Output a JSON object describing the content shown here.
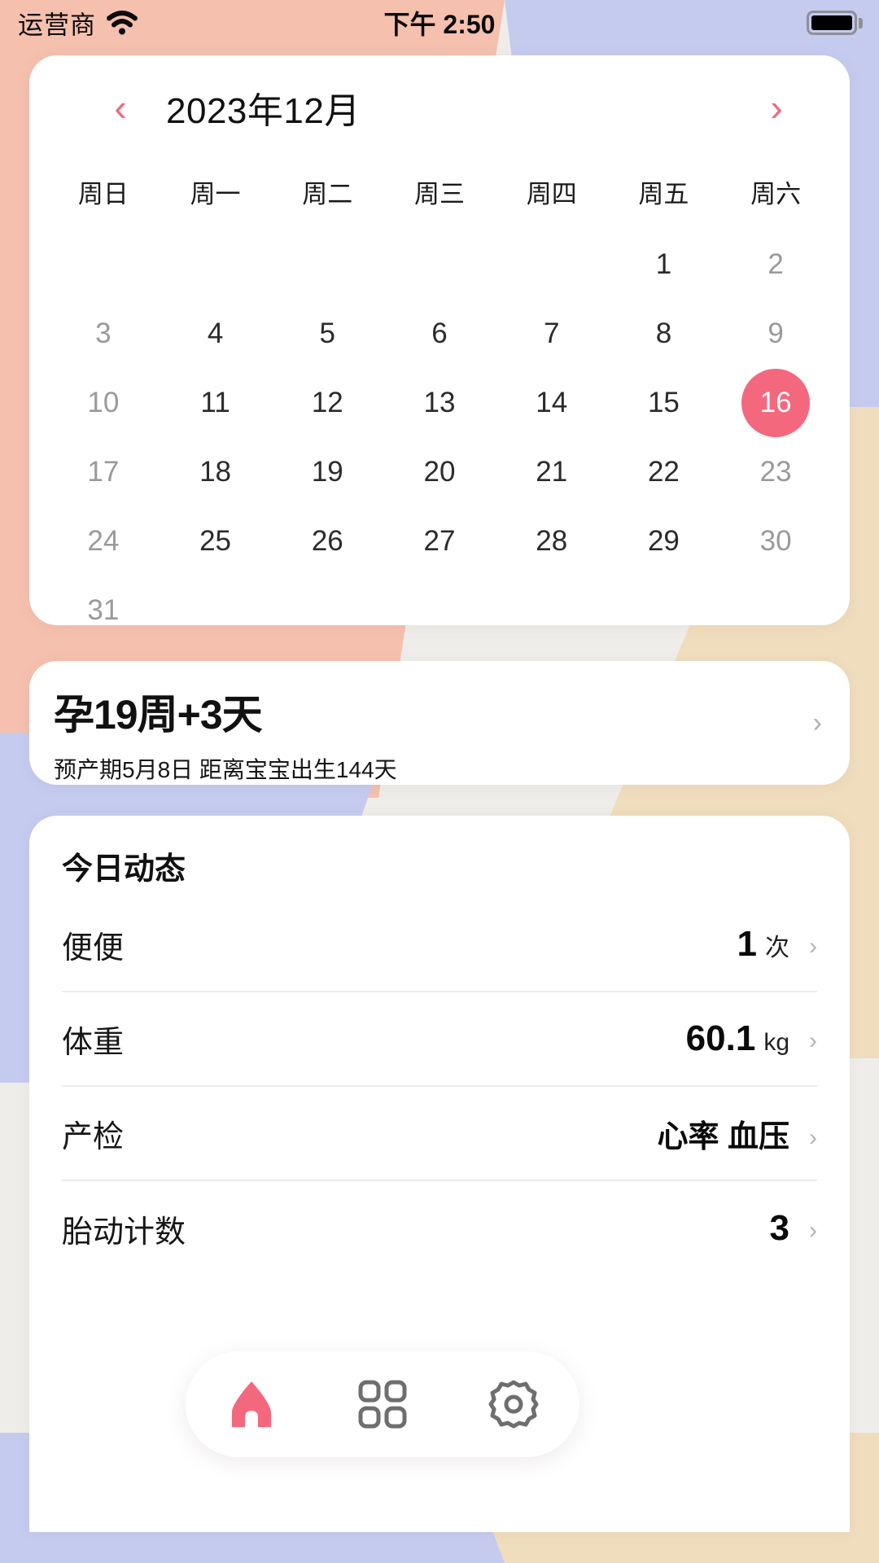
{
  "status_bar": {
    "carrier": "运营商",
    "wifi_icon": "wifi-icon",
    "time": "下午 2:50",
    "battery_icon": "battery-icon"
  },
  "calendar": {
    "prev_label": "‹",
    "next_label": "›",
    "title": "2023年12月",
    "weekdays": [
      "周日",
      "周一",
      "周二",
      "周三",
      "周四",
      "周五",
      "周六"
    ],
    "selected_day": 16,
    "accent_color": "#F4687E",
    "weeks": [
      [
        "",
        "",
        "",
        "",
        "",
        "1",
        "2"
      ],
      [
        "3",
        "4",
        "5",
        "6",
        "7",
        "8",
        "9"
      ],
      [
        "10",
        "11",
        "12",
        "13",
        "14",
        "15",
        "16"
      ],
      [
        "17",
        "18",
        "19",
        "20",
        "21",
        "22",
        "23"
      ],
      [
        "24",
        "25",
        "26",
        "27",
        "28",
        "29",
        "30"
      ],
      [
        "31",
        "",
        "",
        "",
        "",
        "",
        ""
      ]
    ]
  },
  "pregnancy": {
    "title": "孕19周+3天",
    "subtitle": "预产期5月8日 距离宝宝出生144天",
    "chevron": "›"
  },
  "today": {
    "title": "今日动态",
    "rows": [
      {
        "label": "便便",
        "value": "1",
        "unit": "次",
        "chevron": "›"
      },
      {
        "label": "体重",
        "value": "60.1",
        "unit": "kg",
        "chevron": "›"
      },
      {
        "label": "产检",
        "value": "",
        "unit": "心率 血压",
        "chevron": "›"
      },
      {
        "label": "胎动计数",
        "value": "3",
        "unit": "",
        "chevron": "›"
      }
    ]
  },
  "tabbar": {
    "items": [
      {
        "icon": "home-icon",
        "active": true
      },
      {
        "icon": "grid-icon",
        "active": false
      },
      {
        "icon": "gear-icon",
        "active": false
      }
    ],
    "active_color": "#F4687E",
    "inactive_color": "#6e6e6e"
  },
  "background": {
    "salmon": "#F5C0AE",
    "lavender": "#C5CBEF",
    "cream": "#F0DDBD",
    "gray": "#EFEDEA"
  }
}
